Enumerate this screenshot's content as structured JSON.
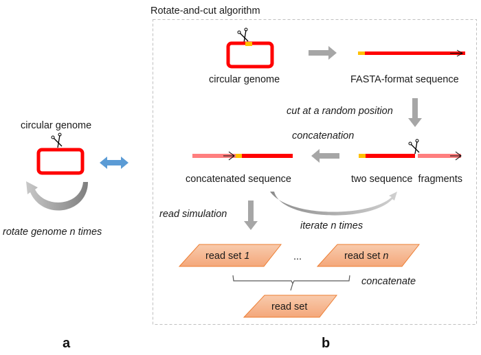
{
  "panel_a": {
    "label": "a",
    "genome_label": "circular genome",
    "rotate_label_prefix": "rotate genome ",
    "rotate_label_n": "n",
    "rotate_label_suffix": " times"
  },
  "panel_b": {
    "label": "b",
    "title": "Rotate-and-cut algorithm",
    "circular_genome_label": "circular genome",
    "fasta_label": "FASTA-format sequence",
    "cut_label": "cut at a random position",
    "concatenation_label": "concatenation",
    "concatenated_label": "concatenated sequence",
    "fragments_label": "two sequence  fragments",
    "read_simulation_label": "read simulation",
    "iterate_label": "iterate n times",
    "read_set_1_prefix": "read set ",
    "read_set_1_index": "1",
    "ellipsis": "...",
    "read_set_n_prefix": "read set ",
    "read_set_n_index": "n",
    "concatenate_label": "concatenate",
    "read_set_final": "read set"
  },
  "colors": {
    "genome_red": "#ff0000",
    "marker_yellow": "#ffc000",
    "fragment_pink": "#ff7f7f",
    "arrow_gray": "#a6a6a6",
    "double_arrow_blue": "#5b9bd5",
    "read_set_fill": "#f4b183",
    "read_set_stroke": "#ed7d31",
    "dashed_border": "#bfbfbf"
  }
}
